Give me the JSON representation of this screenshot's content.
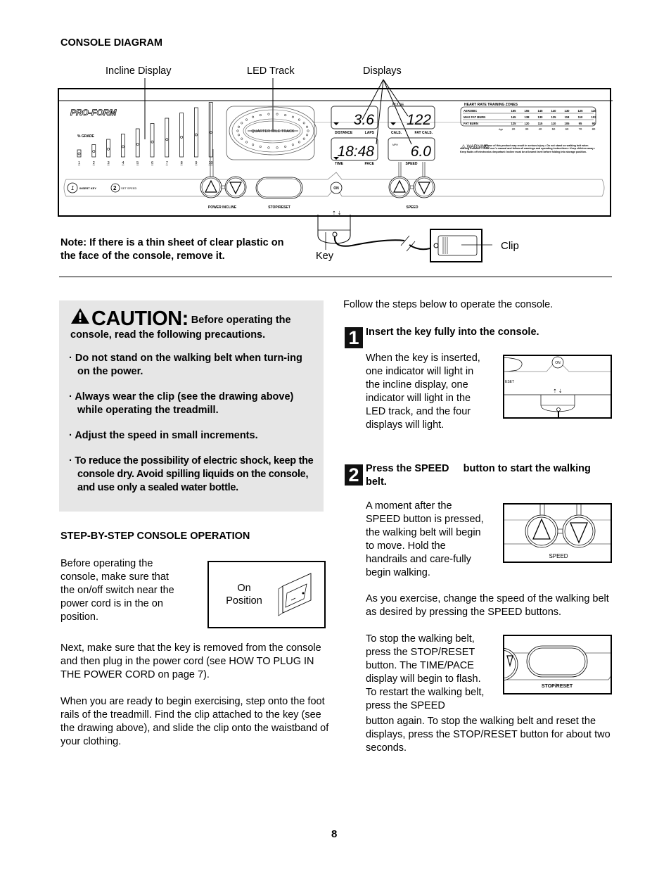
{
  "section_title": "CONSOLE DIAGRAM",
  "callouts": {
    "incline_display": "Incline Display",
    "led_track": "LED Track",
    "displays": "Displays"
  },
  "console": {
    "brand": "PRO-FORM",
    "grade_label": "% GRADE",
    "grade_levels": [
      "1",
      "2",
      "3",
      "4",
      "5",
      "6",
      "7",
      "8",
      "9",
      "10"
    ],
    "track_label": "QUARTER MILE TRACK",
    "displays": [
      {
        "value": "3.6",
        "labels": [
          "DISTANCE",
          "LAPS"
        ]
      },
      {
        "value": "122",
        "labels": [
          "CALS.",
          "FAT CALS."
        ],
        "top_label": "PULSE"
      },
      {
        "value": "18:48",
        "labels": [
          "TIME",
          "PACE"
        ]
      },
      {
        "value": "6.0",
        "labels": [
          "SPEED"
        ],
        "unit": "MPH"
      }
    ],
    "hr_zones": {
      "title": "HEART RATE TRAINING ZONES",
      "rows": [
        {
          "name": "AEROBIC",
          "values": [
            "165",
            "155",
            "145",
            "140",
            "130",
            "125",
            "115"
          ]
        },
        {
          "name": "MAX FAT BURN",
          "values": [
            "145",
            "138",
            "130",
            "125",
            "118",
            "110",
            "103"
          ]
        },
        {
          "name": "FAT BURN",
          "values": [
            "125",
            "120",
            "115",
            "110",
            "105",
            "95",
            "90"
          ]
        }
      ],
      "age_label": "Age",
      "ages": [
        "20",
        "30",
        "40",
        "50",
        "60",
        "70",
        "80"
      ]
    },
    "warning_title": "WARNING:",
    "warning_text": "Misuse of this product may result in serious injury • Do not stand on walking belt when starting treadmill • Read user's manual and follow all warnings and operating instructions • Keep children away • Keep fluids off electronics •Important: Incline must be at lowest level before folding into storage position.",
    "step1_label": "INSERT KEY",
    "step2_label": "SET SPEED",
    "power_incline_label": "POWER INCLINE",
    "stop_reset_label": "STOP/RESET",
    "on_label": "ON",
    "speed_label": "SPEED"
  },
  "note": "Note: If there is a thin sheet of clear plastic on the face of the console, remove it.",
  "key_label": "Key",
  "clip_label": "Clip",
  "caution": {
    "title": "CAUTION:",
    "intro": "Before operating the console, read the following precautions.",
    "items": [
      "Do not stand on the walking belt when turn-ing on the power.",
      "Always wear the clip (see the drawing above) while operating the treadmill.",
      "Adjust the speed in small increments.",
      "To reduce the possibility of electric shock, keep the console dry. Avoid spilling liquids on the console, and use only a sealed water bottle."
    ]
  },
  "step_by_step": {
    "title": "STEP-BY-STEP CONSOLE OPERATION",
    "para1": "Before operating the console, make sure that the on/off switch near the power cord is in the on position.",
    "on_position_label_1": "On",
    "on_position_label_2": "Position",
    "para2": "Next, make sure that the key is removed from the console and then plug in the power cord (see HOW TO PLUG IN THE POWER CORD on page 7).",
    "para3": "When you are ready to begin exercising, step onto the foot rails of the treadmill. Find the clip attached to the key (see the drawing above), and slide the clip onto the waistband of your clothing."
  },
  "right_column": {
    "intro": "Follow the steps below to operate the console.",
    "step1": {
      "number": "1",
      "heading": "Insert the key fully into the console.",
      "body": "When the key is inserted, one indicator will light in the incline display, one indicator will light in the LED track, and the four displays will light.",
      "fig_reset": "ESET",
      "fig_on": "ON"
    },
    "step2": {
      "number": "2",
      "heading_a": "Press the SPEED",
      "heading_b": "button to start the walking belt.",
      "body1": "A moment after the SPEED    button is pressed, the walking belt will begin to move. Hold the handrails and care-fully begin walking.",
      "fig_speed": "SPEED",
      "body2": "As you exercise, change the speed of the walking belt as desired by pressing the SPEED buttons.",
      "body3a": "To stop the walking belt, press the STOP/RESET button. The TIME/PACE display will begin to flash. To restart the walking belt, press the SPEED",
      "body3b": "button again. To stop the walking belt and reset the displays, press the STOP/RESET button for about two seconds.",
      "fig_stop_reset": "STOP/RESET"
    }
  },
  "page_number": "8"
}
